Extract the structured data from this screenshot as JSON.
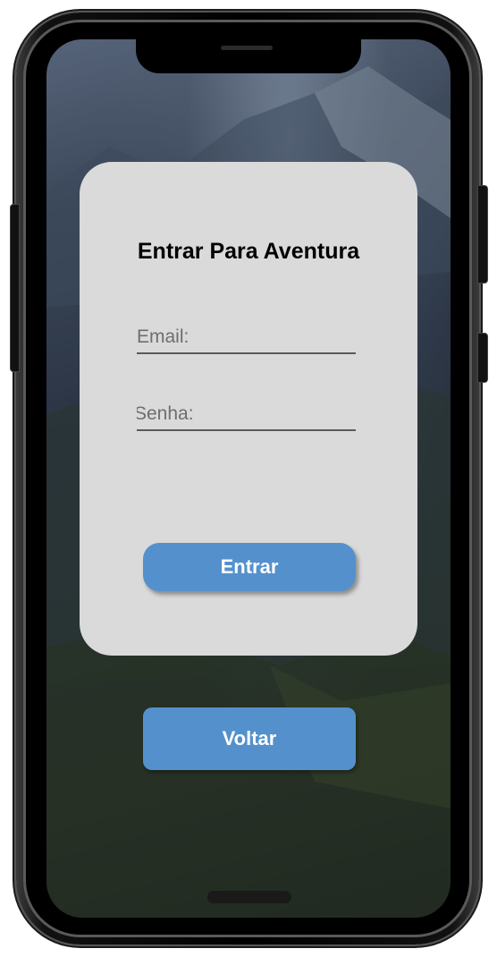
{
  "login": {
    "title": "Entrar Para Aventura",
    "email_placeholder": "Email:",
    "email_value": "",
    "senha_placeholder": "Senha:",
    "senha_value": "",
    "entrar_label": "Entrar"
  },
  "footer": {
    "voltar_label": "Voltar"
  },
  "colors": {
    "button": "#5491cc",
    "card": "#dadada",
    "button_text": "#ffffff"
  },
  "icons": {
    "device": "phone-frame"
  }
}
